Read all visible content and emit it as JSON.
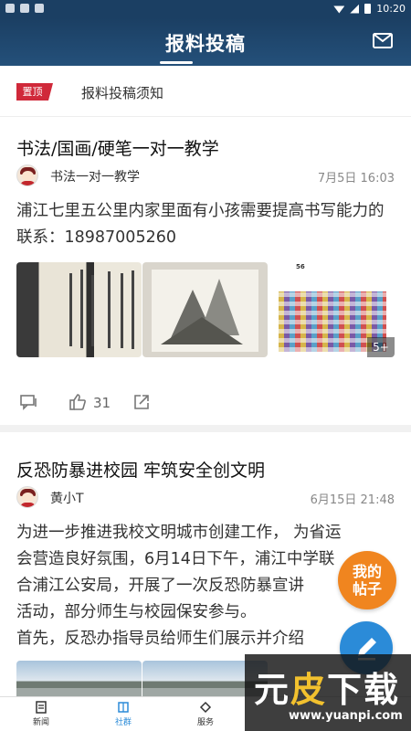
{
  "status_bar": {
    "time": "10:20"
  },
  "header": {
    "title": "报料投稿"
  },
  "notice": {
    "badge": "置顶",
    "text": "报料投稿须知"
  },
  "posts": [
    {
      "title": "书法/国画/硬笔一对一教学",
      "author": "书法一对一教学",
      "time": "7月5日 16:03",
      "body": "浦江七里五公里内家里面有小孩需要提高书写能力的联系：18987005260",
      "images_more": "5+",
      "qr_count": "56",
      "likes": "31"
    },
    {
      "title": "反恐防暴进校园 牢筑安全创文明",
      "author": "黄小T",
      "time": "6月15日 21:48",
      "body_lines": [
        "为进一步推进我校文明城市创建工作， 为省运",
        "会营造良好氛围，6月14日下午，浦江中学联",
        "合浦江公安局，开展了一次反恐防暴宣讲",
        "活动，部分师生与校园保安参与。",
        "首先，反恐办指导员给师生们展示并介绍"
      ]
    }
  ],
  "fab": {
    "my_posts_line1": "我的",
    "my_posts_line2": "帖子"
  },
  "tabs": [
    {
      "label": "新闻"
    },
    {
      "label": "社群"
    },
    {
      "label": "服务"
    }
  ],
  "watermark": {
    "brand": "元皮下载",
    "url": "www.yuanpi.com"
  },
  "colors": {
    "header": "#1b3f63",
    "accent": "#2b8bd8",
    "badge": "#d0293a",
    "fab": "#f0851f"
  }
}
